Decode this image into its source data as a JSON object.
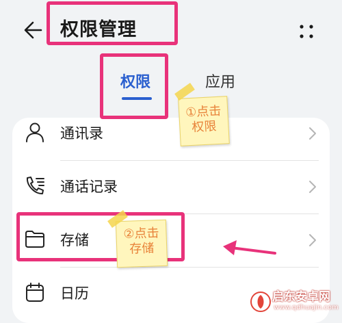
{
  "header": {
    "back_icon": "arrow-left-icon",
    "title": "权限管理",
    "more_icon": "more-dots-icon"
  },
  "tabs": [
    {
      "label": "权限",
      "selected": true
    },
    {
      "label": "应用",
      "selected": false
    }
  ],
  "permission_list": [
    {
      "label": "通讯录",
      "icon": "contacts-icon"
    },
    {
      "label": "通话记录",
      "icon": "call-log-icon"
    },
    {
      "label": "存储",
      "icon": "folder-icon"
    },
    {
      "label": "日历",
      "icon": "calendar-icon"
    }
  ],
  "annotations": {
    "note1_line1": "①点击",
    "note1_line2": "权限",
    "note2_line1": "②点击",
    "note2_line2": "存储",
    "highlight_color": "#e8327a"
  },
  "watermark": {
    "text": "启东安卓网",
    "url": "www.qdhuajin.com"
  },
  "colors": {
    "accent": "#2a5fcf",
    "background": "#f1f3f5",
    "card": "#ffffff"
  }
}
